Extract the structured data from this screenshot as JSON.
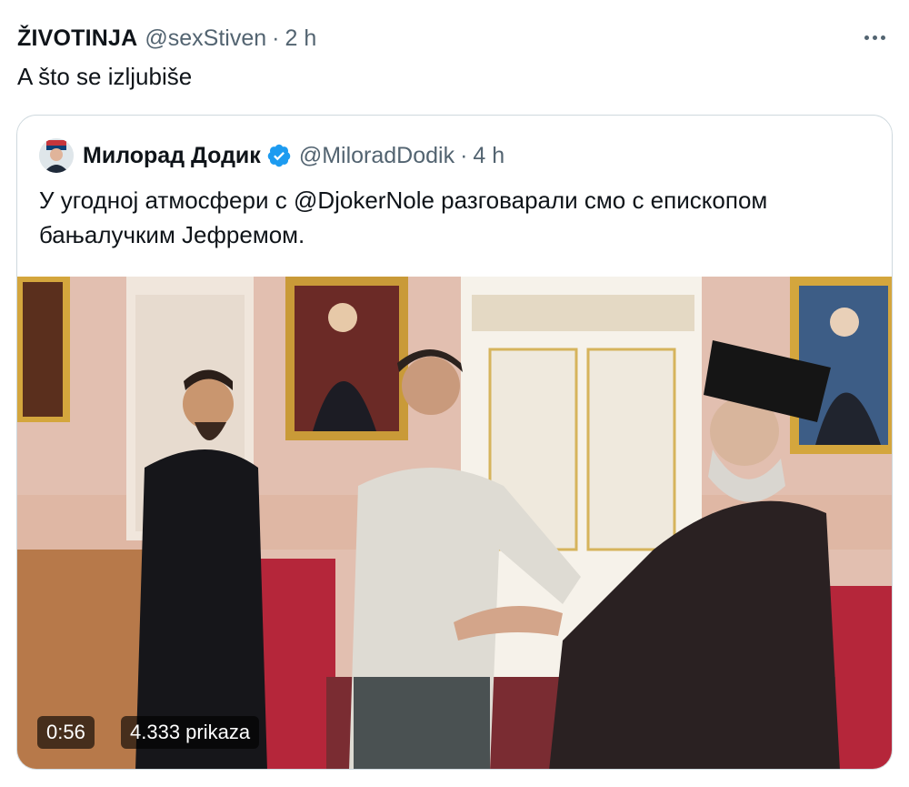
{
  "tweet": {
    "author_name": "ŽIVOTINJA",
    "author_handle": "@sexStiven",
    "separator": "·",
    "time": "2 h",
    "text": "A što se izljubiše",
    "more_icon": "more-horizontal-icon"
  },
  "quoted_tweet": {
    "author_name": "Милорад Додик",
    "verified_icon": "verified-badge-icon",
    "verified_color": "#1d9bf0",
    "author_handle": "@MiloradDodik",
    "separator": "·",
    "time": "4 h",
    "text": "У угодној атмосфери с @DjokerNole разговарали смо с епископом бањалучким Јефремом.",
    "media": {
      "type": "video",
      "duration": "0:56",
      "views": "4.333 prikaza"
    }
  },
  "colors": {
    "text_primary": "#0f1419",
    "text_secondary": "#536471",
    "border": "#cfd9de",
    "verified": "#1d9bf0"
  }
}
